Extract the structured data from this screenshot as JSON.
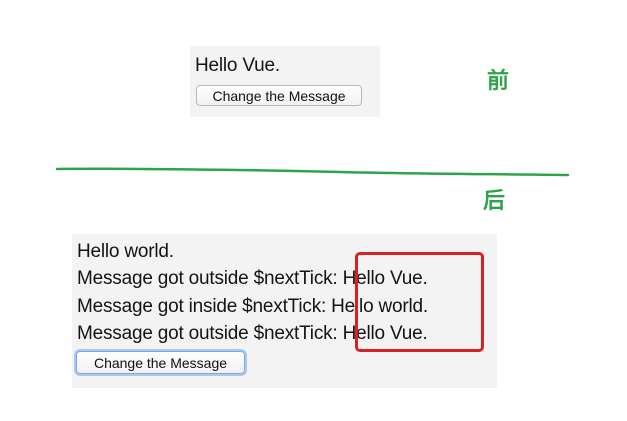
{
  "before": {
    "message": "Hello Vue.",
    "button_label": "Change the Message"
  },
  "after": {
    "lines": [
      "Hello world.",
      "Message got outside $nextTick: Hello Vue.",
      "Message got inside $nextTick: Hello world.",
      "Message got outside $nextTick: Hello Vue."
    ],
    "button_label": "Change the Message"
  },
  "annotations": {
    "before_label": "前",
    "after_label": "后",
    "label_color": "#2ea34a",
    "divider_color": "#2ea34a",
    "highlight_color": "#d52323"
  }
}
